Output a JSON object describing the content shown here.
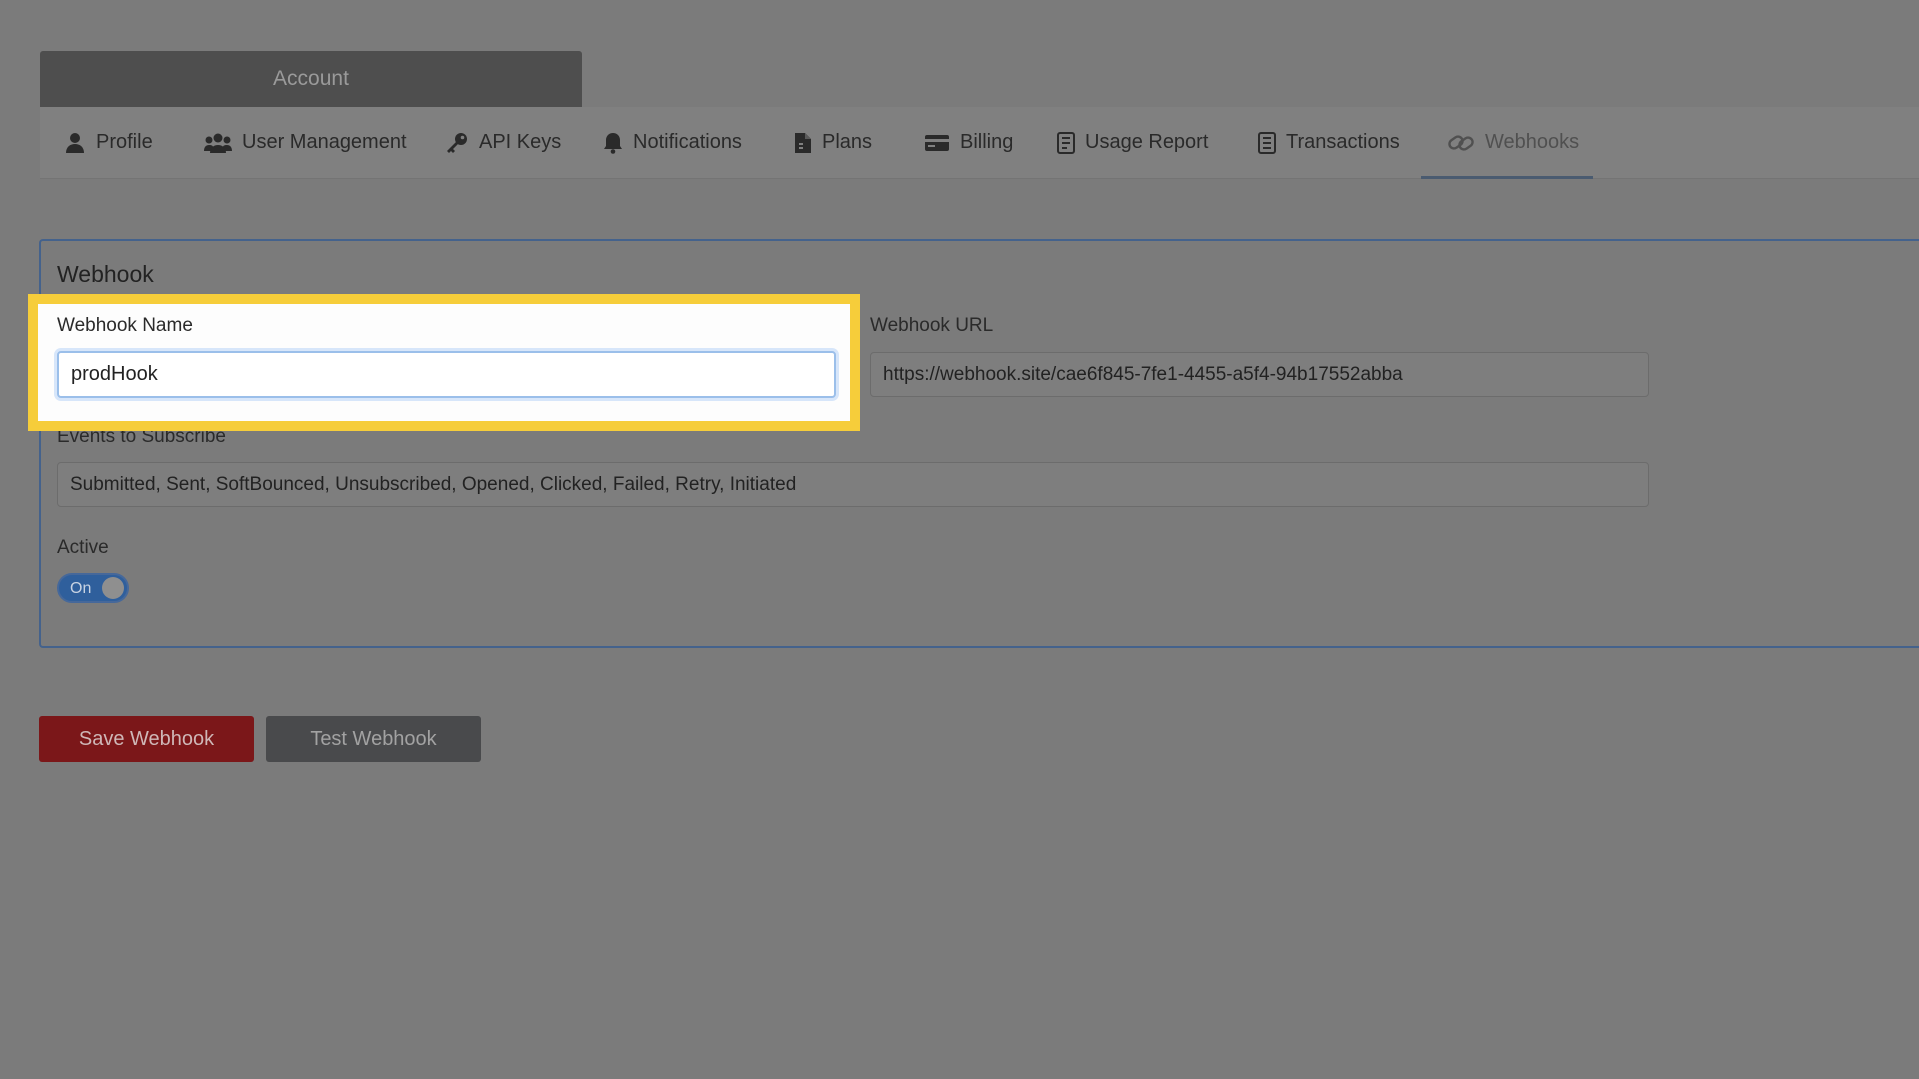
{
  "header": {
    "title": "Account"
  },
  "tabs": [
    {
      "label": "Profile",
      "icon": "user-icon"
    },
    {
      "label": "User Management",
      "icon": "users-icon"
    },
    {
      "label": "API Keys",
      "icon": "key-icon"
    },
    {
      "label": "Notifications",
      "icon": "bell-icon"
    },
    {
      "label": "Plans",
      "icon": "file-icon"
    },
    {
      "label": "Billing",
      "icon": "credit-card-icon"
    },
    {
      "label": "Usage Report",
      "icon": "report-icon"
    },
    {
      "label": "Transactions",
      "icon": "receipt-icon"
    },
    {
      "label": "Webhooks",
      "icon": "link-icon",
      "active": true
    }
  ],
  "form": {
    "title": "Webhook",
    "name_label": "Webhook Name",
    "name_value": "prodHook",
    "url_label": "Webhook URL",
    "url_value": "https://webhook.site/cae6f845-7fe1-4455-a5f4-94b17552abba",
    "events_label": "Events to Subscribe",
    "events_value": "Submitted, Sent, SoftBounced, Unsubscribed, Opened, Clicked, Failed, Retry, Initiated",
    "active_label": "Active",
    "active_toggle_text": "On"
  },
  "buttons": {
    "save": "Save Webhook",
    "test": "Test Webhook"
  },
  "colors": {
    "highlight": "#f6cd3a",
    "save_button": "#7b1719",
    "toggle_on": "#2f5f9c"
  }
}
